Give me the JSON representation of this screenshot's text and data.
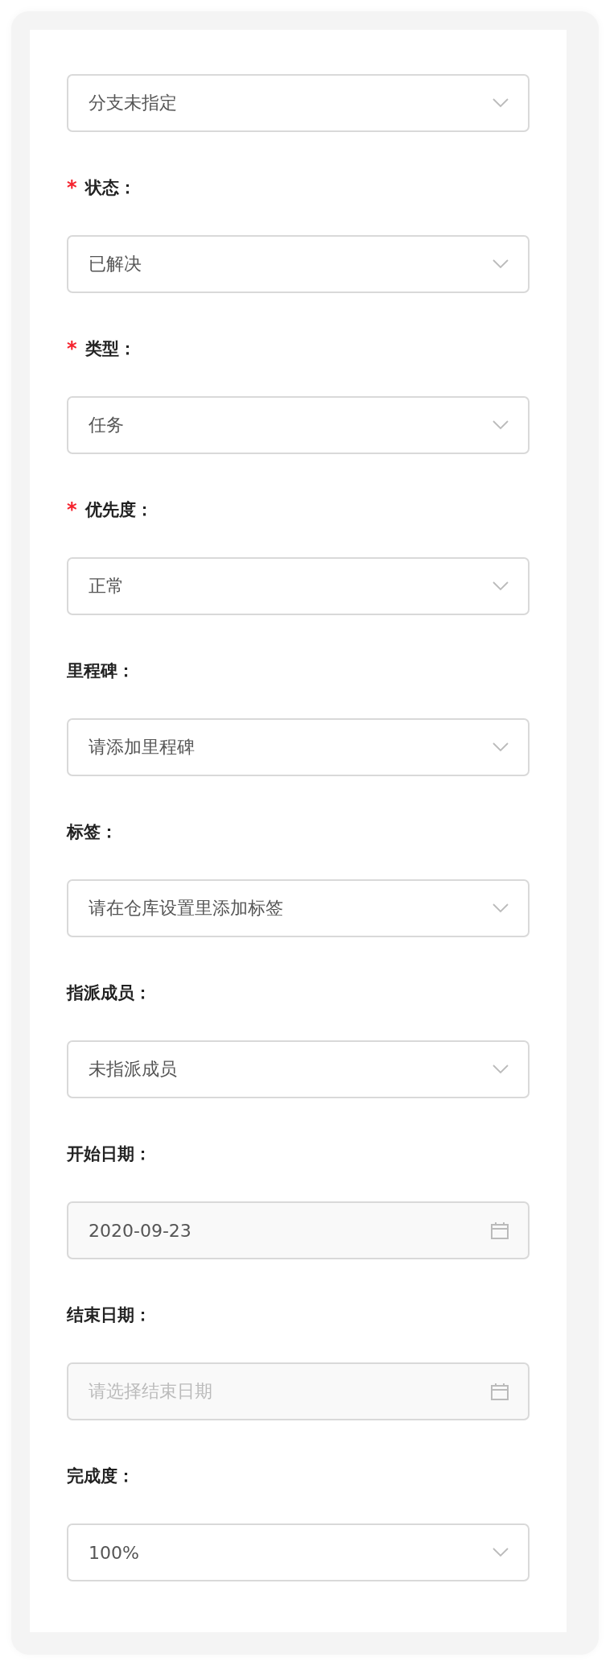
{
  "fields": [
    {
      "kind": "select",
      "value": "分支未指定"
    },
    {
      "label": "状态：",
      "required_mark": "*",
      "kind": "select",
      "value": "已解决"
    },
    {
      "label": "类型：",
      "required_mark": "*",
      "kind": "select",
      "value": "任务"
    },
    {
      "label": "优先度：",
      "required_mark": "*",
      "kind": "select",
      "value": "正常"
    },
    {
      "label": "里程碑：",
      "kind": "select",
      "value": "请添加里程碑"
    },
    {
      "label": "标签：",
      "kind": "select",
      "value": "请在仓库设置里添加标签"
    },
    {
      "label": "指派成员：",
      "kind": "select",
      "value": "未指派成员"
    },
    {
      "label": "开始日期：",
      "kind": "date",
      "value": "2020-09-23"
    },
    {
      "label": "结束日期：",
      "kind": "date",
      "placeholder": "请选择结束日期"
    },
    {
      "label": "完成度：",
      "kind": "select",
      "value": "100%"
    }
  ]
}
